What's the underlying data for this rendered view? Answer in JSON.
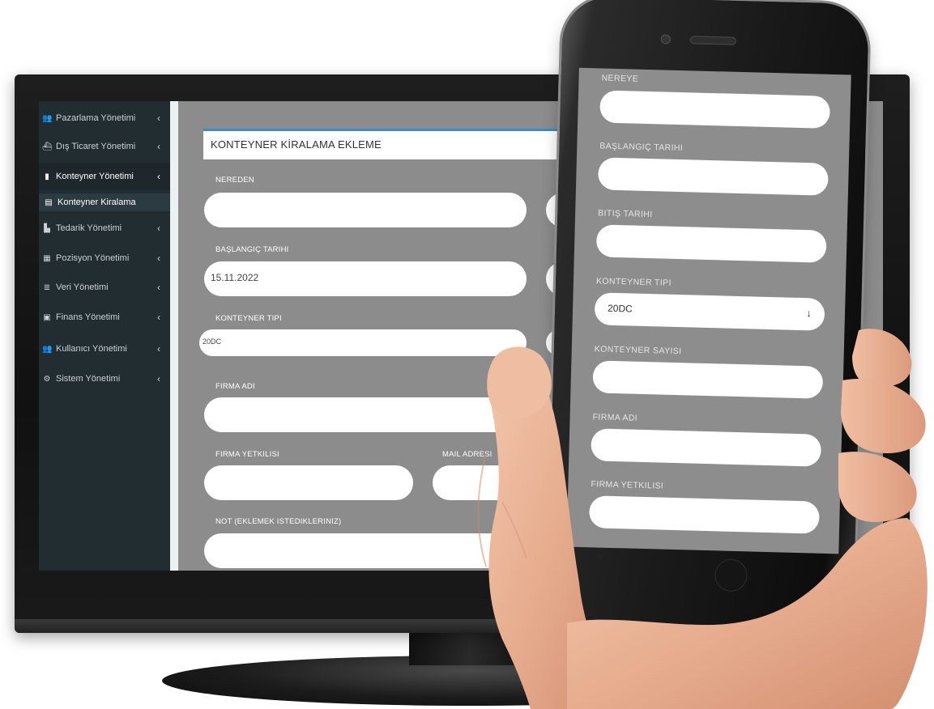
{
  "sidebar": {
    "items": [
      {
        "label": "Pazarlama Yönetimi",
        "icon": "users-icon",
        "glyph": "👥",
        "active": false
      },
      {
        "label": "Dış Ticaret Yönetimi",
        "icon": "ship-icon",
        "glyph": "⛴",
        "active": false
      },
      {
        "label": "Konteyner Yönetimi",
        "icon": "container-icon",
        "glyph": "▮",
        "active": true
      },
      {
        "label": "Tedarik Yönetimi",
        "icon": "supply-icon",
        "glyph": "▙",
        "active": false
      },
      {
        "label": "Pozisyon Yönetimi",
        "icon": "position-icon",
        "glyph": "▦",
        "active": false
      },
      {
        "label": "Veri Yönetimi",
        "icon": "database-icon",
        "glyph": "≣",
        "active": false
      },
      {
        "label": "Finans Yönetimi",
        "icon": "money-icon",
        "glyph": "▣",
        "active": false
      },
      {
        "label": "Kullanıcı Yönetimi",
        "icon": "users-icon",
        "glyph": "👥",
        "active": false
      },
      {
        "label": "Sistem Yönetimi",
        "icon": "cogs-icon",
        "glyph": "⚙",
        "active": false
      }
    ],
    "sub_item": {
      "label": "Konteyner Kiralama",
      "icon": "file-icon",
      "glyph": "▤"
    },
    "chevron": "‹"
  },
  "desktop_form": {
    "title": "KONTEYNER KİRALAMA EKLEME",
    "nereden_label": "NEREDEN",
    "nereden_value": "",
    "baslangic_label": "BAŞLANGIÇ TARIHI",
    "baslangic_value": "15.11.2022",
    "konteyner_tipi_label": "KONTEYNER TIPI",
    "konteyner_tipi_value": "20DC",
    "firma_adi_label": "FIRMA ADI",
    "firma_yetkilisi_label": "FIRMA YETKILISI",
    "mail_adresi_label": "MAIL ADRESI",
    "not_label": "NOT (EKLEMEK ISTEDIKLERINIZ)"
  },
  "mobile_form": {
    "nereye_label": "NEREYE",
    "baslangic_label": "BAŞLANGIÇ TARIHI",
    "bitis_label": "BITIŞ TARIHI",
    "konteyner_tipi_label": "KONTEYNER TIPI",
    "konteyner_tipi_value": "20DC",
    "select_arrow": "↓",
    "konteyner_sayisi_label": "KONTEYNER SAYISI",
    "firma_adi_label": "FIRMA ADI",
    "firma_yetkilisi_label": "FIRMA YETKILISI"
  },
  "colors": {
    "sidebar_bg": "#222d32",
    "sidebar_active": "#1e282c",
    "sidebar_sub": "#2c3b41",
    "accent": "#3c8dbc",
    "screen_bg": "#8c8c8c",
    "input_bg": "#ffffff"
  }
}
